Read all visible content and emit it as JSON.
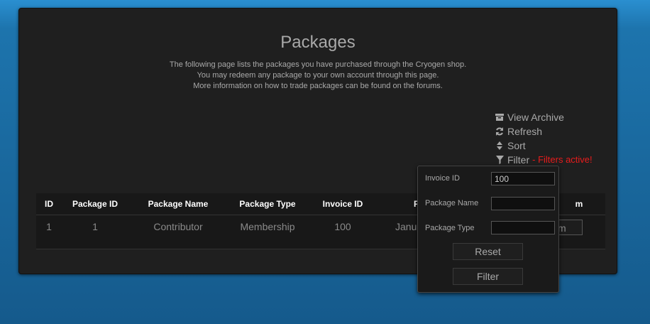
{
  "page": {
    "title": "Packages",
    "intro": [
      "The following page lists the packages you have purchased through the Cryogen shop.",
      "You may redeem any package to your own account through this page.",
      "More information on how to trade packages can be found on the forums."
    ]
  },
  "actions": {
    "view_archive": "View Archive",
    "refresh": "Refresh",
    "sort": "Sort",
    "filter": "Filter",
    "filters_active": "- Filters active!",
    "icons": [
      "archive-icon",
      "refresh-icon",
      "sort-icon",
      "filter-icon"
    ]
  },
  "table": {
    "columns": [
      "ID",
      "Package ID",
      "Package Name",
      "Package Type",
      "Invoice ID",
      "P",
      "m"
    ],
    "rows": [
      {
        "id": "1",
        "package_id": "1",
        "package_name": "Contributor",
        "package_type": "Membership",
        "invoice_id": "100",
        "partial": "Janu",
        "button": "m"
      }
    ]
  },
  "filter_popup": {
    "invoice_id_label": "Invoice ID",
    "invoice_id_value": "100",
    "package_name_label": "Package Name",
    "package_name_value": "",
    "package_type_label": "Package Type",
    "package_type_value": "",
    "reset_label": "Reset",
    "filter_label": "Filter"
  },
  "colors": {
    "panel": "#1f1f1f",
    "text": "#a9a9a9",
    "alert": "#e81c1c"
  }
}
